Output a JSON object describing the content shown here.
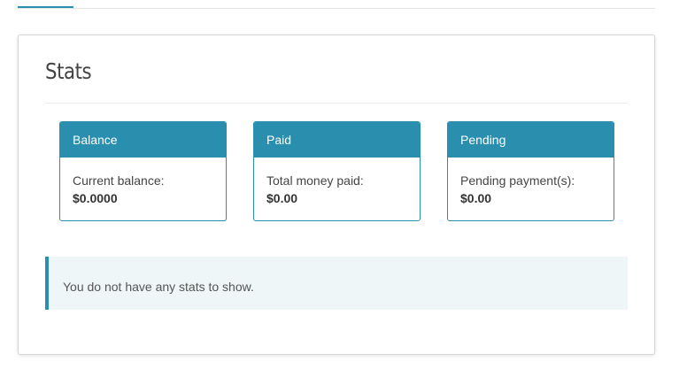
{
  "panel": {
    "title": "Stats"
  },
  "cards": [
    {
      "header": "Balance",
      "label": "Current balance:",
      "value": "$0.0000"
    },
    {
      "header": "Paid",
      "label": "Total money paid:",
      "value": "$0.00"
    },
    {
      "header": "Pending",
      "label": "Pending payment(s):",
      "value": "$0.00"
    }
  ],
  "notice": {
    "text": "You do not have any stats to show."
  },
  "colors": {
    "accent": "#2a8faf",
    "notice_background": "#eef6f8"
  }
}
